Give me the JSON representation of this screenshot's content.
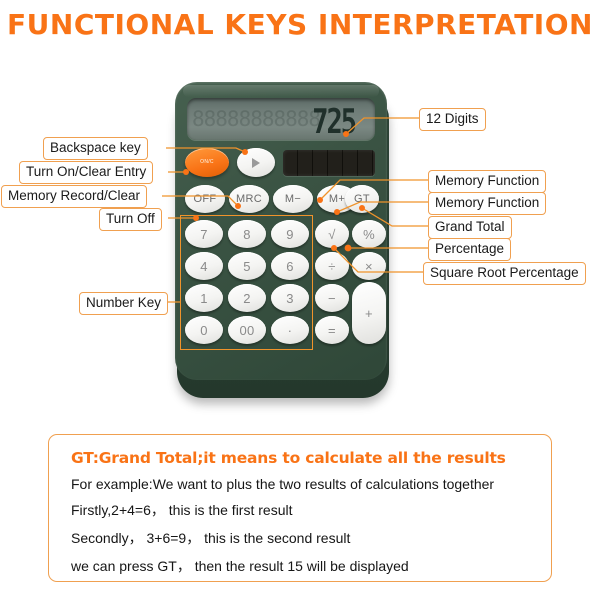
{
  "page": {
    "title": "FUNCTIONAL KEYS INTERPRETATION",
    "accent_color": "#f97316",
    "label_border_color": "#f0a050",
    "calculator_body_color": "#3a5343"
  },
  "calculator": {
    "display": {
      "value": "725",
      "ghost_segments": "88888888888",
      "digits_capacity": "12"
    },
    "power_key": {
      "label": "ON/C",
      "color": "#f97316"
    },
    "backspace_key": {
      "icon": "triangle-right-icon"
    },
    "solar_panel": {
      "name": "solar-panel"
    },
    "function_row": [
      "OFF",
      "MRC",
      "M−",
      "M+",
      "GT"
    ],
    "keypad_rows": [
      [
        "7",
        "8",
        "9",
        "√",
        "%"
      ],
      [
        "4",
        "5",
        "6",
        "÷",
        "×"
      ],
      [
        "1",
        "2",
        "3",
        "−",
        "+"
      ],
      [
        "0",
        "00",
        "·",
        "=",
        ""
      ]
    ]
  },
  "callouts": {
    "left": [
      {
        "text": "Backspace key"
      },
      {
        "text": "Turn On/Clear Entry"
      },
      {
        "text": "Memory Record/Clear"
      },
      {
        "text": "Turn Off"
      },
      {
        "text": "Number Key"
      }
    ],
    "right": [
      {
        "text": "12 Digits"
      },
      {
        "text": "Memory Function"
      },
      {
        "text": "Memory Function"
      },
      {
        "text": "Grand Total"
      },
      {
        "text": "Percentage"
      },
      {
        "text": "Square Root Percentage"
      }
    ]
  },
  "gt_panel": {
    "heading": "GT:Grand Total;it means to calculate all the results",
    "lines": [
      "For example:We want to plus the two  results of calculations together",
      "Firstly,2+4=6， this is the first result",
      "Secondly， 3+6=9， this is the second result",
      "we can press GT， then the result 15 will be displayed"
    ]
  }
}
